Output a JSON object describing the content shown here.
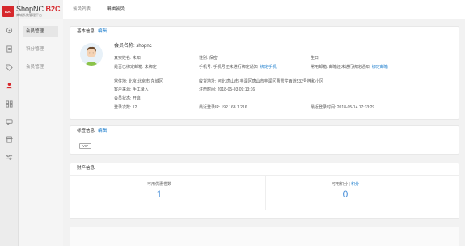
{
  "logo": {
    "badge": "B2C",
    "title_part1": "ShopNC ",
    "title_part2": "B2C",
    "subtitle": "商城系统管理平台"
  },
  "rail_icons": [
    "dashboard-icon",
    "document-icon",
    "tag-icon",
    "member-icon",
    "grid-icon",
    "chat-icon",
    "shop-icon",
    "settings-icon"
  ],
  "submenu": {
    "items": [
      {
        "label": "会员管理",
        "active": true
      },
      {
        "label": "积分管理",
        "active": false
      },
      {
        "label": "会员管理",
        "active": false
      }
    ]
  },
  "tabs": [
    {
      "label": "会员列表",
      "active": false
    },
    {
      "label": "编辑会员",
      "active": true
    }
  ],
  "basic": {
    "title": "基本信息",
    "edit": "编辑",
    "member_name": "会员名称: shopnc",
    "real_name": "真实姓名: 未知",
    "gender": "性别: 保密",
    "birthday": "生日:",
    "email_bound": "是否已绑定邮箱: 未绑定",
    "mobile": "手机号: 手机号还未进行绑定通知",
    "mobile_link": "绑定手机",
    "common_email": "常用邮箱: 邮箱还未进行绑定通知",
    "email_link": "绑定邮箱",
    "region": "常住地: 北京 北京市 东城区",
    "address": "收货地址: 河北 唐山市 丰润区唐山市丰润区曹雪芹西道532号梓和小区",
    "source": "客户来源: 手工录入",
    "register_time": "注册时间: 2018-05-03 09:13:16",
    "status": "会员状态: 开启",
    "login_count": "登录次数: 12",
    "last_ip": "最近登录IP: 192.168.1.216",
    "last_time": "最近登录时间: 2018-05-14 17:33:29"
  },
  "tags": {
    "title": "标签信息",
    "edit": "编辑",
    "items": [
      "VIP"
    ]
  },
  "assets": {
    "title": "财产信息",
    "coupons_label": "可用优惠卷数",
    "coupons_value": "1",
    "points_label": "可用积分",
    "points_link": "积分",
    "points_sep": " | ",
    "points_value": "0"
  },
  "colors": {
    "accent": "#d6282c",
    "link": "#1a7ccc",
    "value": "#4a90d9"
  }
}
